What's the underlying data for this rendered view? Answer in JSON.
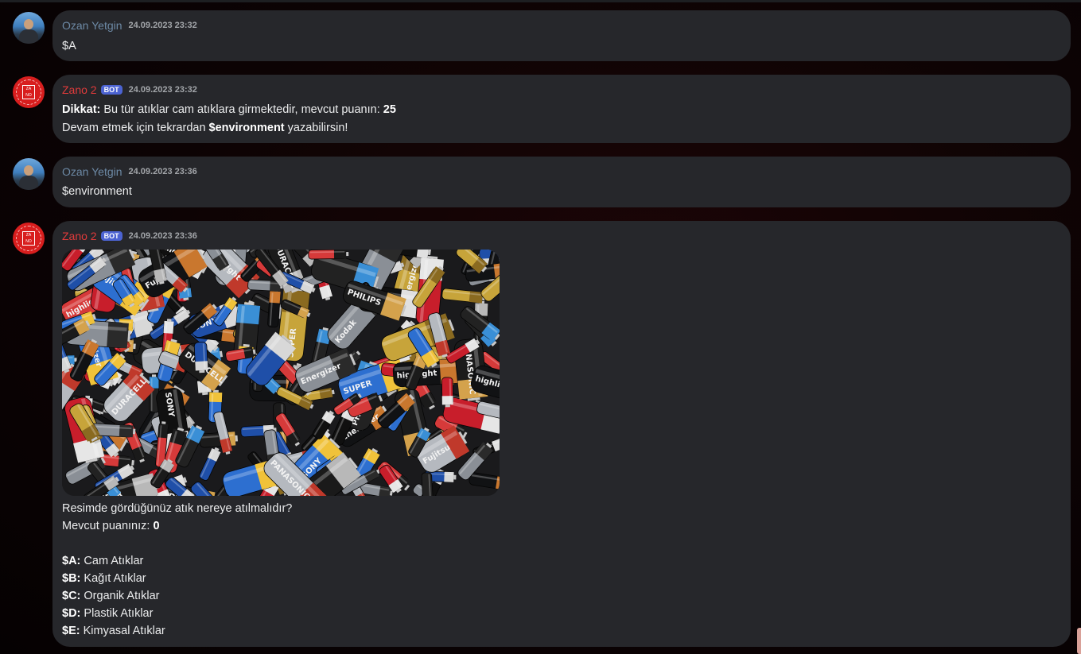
{
  "messages": [
    {
      "author": "Ozan Yetgin",
      "timestamp": "24.09.2023 23:32",
      "text": "$A"
    },
    {
      "author": "Zano 2",
      "badge": "BOT",
      "timestamp": "24.09.2023 23:32",
      "line1": {
        "bold": "Dikkat:",
        "text": " Bu tür atıklar cam atıklara girmektedir, mevcut puanın: ",
        "score": "25"
      },
      "line2": {
        "pre": "Devam etmek için tekrardan ",
        "cmd": "$environment",
        "post": " yazabilirsin!"
      }
    },
    {
      "author": "Ozan Yetgin",
      "timestamp": "24.09.2023 23:36",
      "text": "$environment"
    },
    {
      "author": "Zano 2",
      "badge": "BOT",
      "timestamp": "24.09.2023 23:36",
      "question": "Resimde gördüğünüz atık nereye atılmalıdır?",
      "score_label": "Mevcut puanınız: ",
      "score": "0",
      "options": [
        {
          "key": "$A:",
          "label": " Cam Atıklar"
        },
        {
          "key": "$B:",
          "label": " Kağıt Atıklar"
        },
        {
          "key": "$C:",
          "label": " Organik Atıklar"
        },
        {
          "key": "$D:",
          "label": " Plastik Atıklar"
        },
        {
          "key": "$E:",
          "label": " Kimyasal Atıklar"
        }
      ]
    }
  ],
  "battery_labels": [
    "SONY",
    "Kodak",
    "DURACELL",
    "PHILIPS",
    "Energizer",
    "VARTA",
    "SUPER",
    "PANASONIC",
    "highlight",
    "Fujitsu"
  ],
  "avatar_mark": {
    "top": "ZA",
    "bottom": "NO"
  },
  "colors": {
    "user_name": "#6d8aa6",
    "bot_name": "#e03b3b",
    "bot_badge": "#4c63d2",
    "bubble": "#26272b"
  }
}
